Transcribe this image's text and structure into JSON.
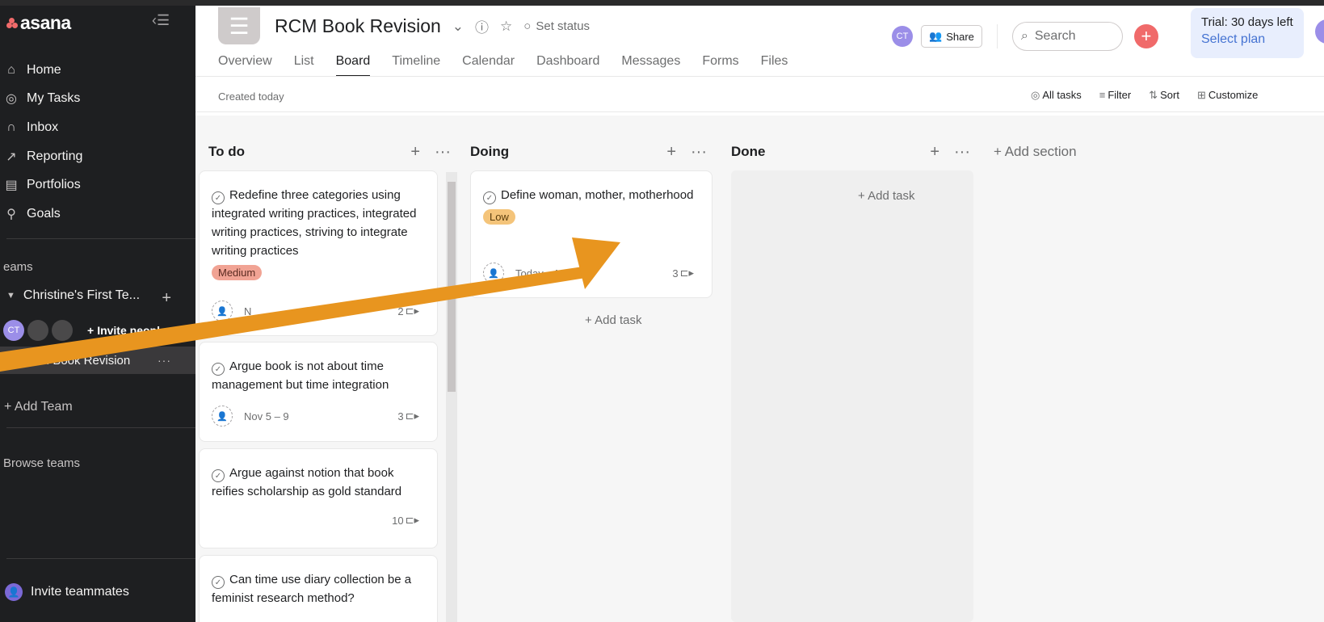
{
  "sidebar": {
    "logo": "asana",
    "nav": [
      {
        "label": "Home",
        "icon": "home-icon",
        "glyph": "⌂"
      },
      {
        "label": "My Tasks",
        "icon": "check-circle-icon",
        "glyph": "✓"
      },
      {
        "label": "Inbox",
        "icon": "bell-icon",
        "glyph": "🔔"
      },
      {
        "label": "Reporting",
        "icon": "reporting-icon",
        "glyph": "⩗"
      },
      {
        "label": "Portfolios",
        "icon": "portfolio-icon",
        "glyph": "▤"
      },
      {
        "label": "Goals",
        "icon": "goals-icon",
        "glyph": "⚲"
      }
    ],
    "teams_label": "eams",
    "team_name": "Christine's First Te...",
    "avatar_initials": "CT",
    "invite_people": "Invite people",
    "project": "RCM Book Revision",
    "add_team": "Add Team",
    "browse_teams": "Browse teams",
    "invite_teammates": "Invite teammates"
  },
  "header": {
    "title": "RCM Book Revision",
    "set_status": "Set status",
    "avatar_initials": "CT",
    "share": "Share",
    "search_placeholder": "Search",
    "trial_line1": "Trial: 30 days left",
    "trial_line2": "Select plan",
    "tabs": [
      "Overview",
      "List",
      "Board",
      "Timeline",
      "Calendar",
      "Dashboard",
      "Messages",
      "Forms",
      "Files"
    ],
    "active_tab": "Board"
  },
  "subheader": {
    "created": "Created today",
    "toolbar": [
      "All tasks",
      "Filter",
      "Sort",
      "Customize"
    ]
  },
  "board": {
    "columns": [
      {
        "name": "To do"
      },
      {
        "name": "Doing"
      },
      {
        "name": "Done"
      }
    ],
    "todo_cards": [
      {
        "title": "Redefine three categories using integrated writing practices, integrated writing practices, striving to integrate writing practices",
        "tag": "Medium",
        "date": "N",
        "subtasks": "2"
      },
      {
        "title": "Argue book is not about time management but time integration",
        "tag": "",
        "date": "Nov 5 – 9",
        "subtasks": "3"
      },
      {
        "title": "Argue against notion that book reifies scholarship as gold standard",
        "tag": "",
        "date": "",
        "subtasks": "10"
      },
      {
        "title": "Can time use diary collection be a feminist research method?",
        "tag": "",
        "date": "",
        "subtasks": ""
      }
    ],
    "doing_cards": [
      {
        "title": "Define woman, mother, motherhood",
        "tag": "Low",
        "date": "Today – Nov 5",
        "subtasks": "3"
      }
    ],
    "add_task": "Add task",
    "add_section": "Add section"
  },
  "colors": {
    "accent": "#f06a6a",
    "arrow": "#e8951f",
    "sidebar": "#1e1f21",
    "medium_tag": "#f1a394",
    "low_tag": "#f4c47a",
    "link": "#4573d2"
  }
}
